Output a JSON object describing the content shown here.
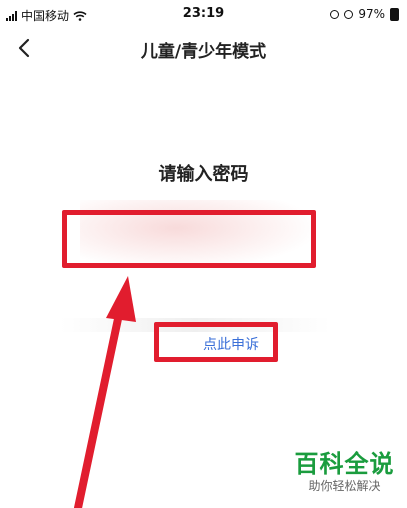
{
  "status_bar": {
    "carrier": "中国移动",
    "time": "23:19",
    "battery": "97%"
  },
  "nav": {
    "title": "儿童/青少年模式",
    "back_icon": "chevron-left-icon"
  },
  "content": {
    "prompt": "请输入密码",
    "appeal_link": "点此申诉"
  },
  "watermark": {
    "title": "百科全说",
    "subtitle": "助你轻松解决"
  },
  "colors": {
    "annotation_red": "#e11d2e",
    "link_blue": "#3a6fd8",
    "watermark_green": "#1a9c3e"
  }
}
